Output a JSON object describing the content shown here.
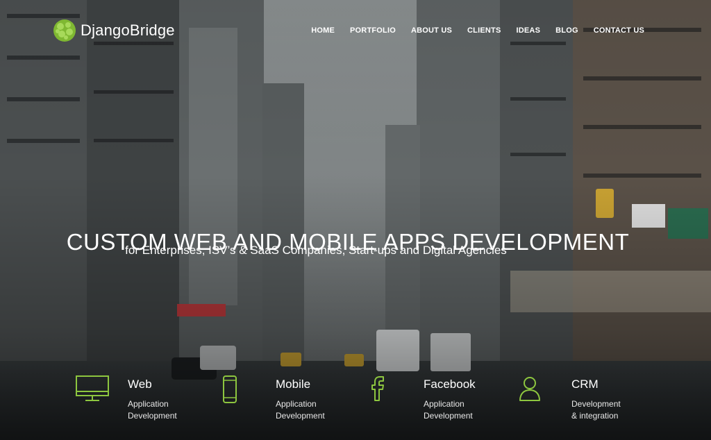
{
  "brand": {
    "name": "DjangoBridge",
    "logo_color": "#8dc63f"
  },
  "nav": {
    "items": [
      "HOME",
      "PORTFOLIO",
      "ABOUT US",
      "CLIENTS",
      "IDEAS",
      "BLOG",
      "CONTACT US"
    ]
  },
  "hero": {
    "headline": "CUSTOM WEB AND MOBILE APPS DEVELOPMENT",
    "subline": "for Enterprises, ISV’s & SaaS Companies, Start-ups and Digital Agencies"
  },
  "services": [
    {
      "icon": "monitor-icon",
      "title": "Web",
      "line1": "Application",
      "line2": "Development"
    },
    {
      "icon": "smartphone-icon",
      "title": "Mobile",
      "line1": "Application",
      "line2": "Development"
    },
    {
      "icon": "facebook-icon",
      "title": "Facebook",
      "line1": "Application",
      "line2": "Development"
    },
    {
      "icon": "user-icon",
      "title": "CRM",
      "line1": "Development",
      "line2": "& integration"
    }
  ],
  "colors": {
    "accent": "#8dc63f",
    "text": "#ffffff"
  }
}
